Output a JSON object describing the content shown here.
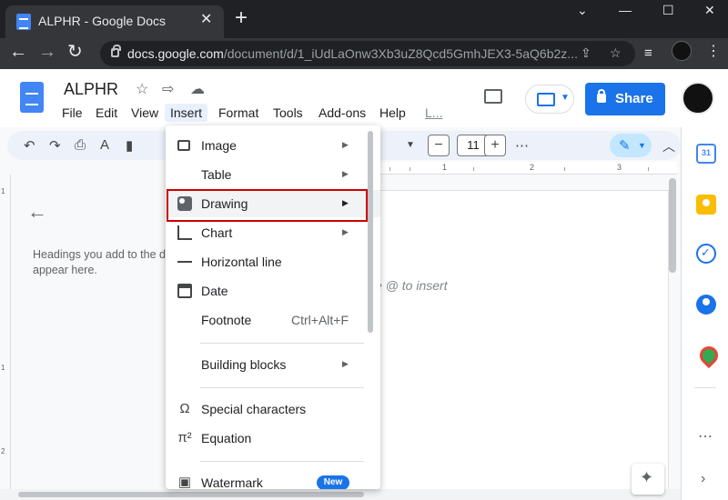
{
  "browser": {
    "tab_title": "ALPHR - Google Docs",
    "url_host": "docs.google.com",
    "url_path": "/document/d/1_iUdLaOnw3Xb3uZ8Qcd5GmhJEX3-5aQ6b2z...",
    "icons": [
      "doc-favicon-icon",
      "close-icon",
      "plus-icon",
      "minimize-icon",
      "maximize-icon",
      "close-window-icon",
      "back-icon",
      "forward-icon",
      "reload-icon",
      "lock-icon",
      "share-icon",
      "star-icon",
      "media-icon",
      "profile-icon",
      "menu-icon"
    ]
  },
  "doc": {
    "title": "ALPHR",
    "menus": [
      "File",
      "Edit",
      "View",
      "Insert",
      "Format",
      "Tools",
      "Add-ons",
      "Help",
      "L..."
    ],
    "active_menu": "Insert",
    "share_label": "Share",
    "accent_color": "#1a73e8"
  },
  "toolbar": {
    "font_size": "11",
    "minus": "−",
    "plus": "+"
  },
  "outline": {
    "hint_line1": "Headings you add to the d",
    "hint_line2": "appear here."
  },
  "page": {
    "placeholder": "e @ to insert"
  },
  "ruler": {
    "h_numbers": [
      "1",
      "2",
      "3"
    ],
    "v_numbers": [
      "1",
      "1",
      "2"
    ]
  },
  "insert_menu": {
    "items": [
      {
        "label": "Image",
        "icon": "image-icon",
        "submenu": true
      },
      {
        "label": "Table",
        "icon": "",
        "submenu": true
      },
      {
        "label": "Drawing",
        "icon": "drawing-icon",
        "submenu": true,
        "highlighted": true
      },
      {
        "label": "Chart",
        "icon": "chart-icon",
        "submenu": true
      },
      {
        "label": "Horizontal line",
        "icon": "horizontal-line-icon",
        "submenu": false
      },
      {
        "label": "Date",
        "icon": "date-icon",
        "submenu": false
      },
      {
        "label": "Footnote",
        "icon": "",
        "shortcut": "Ctrl+Alt+F"
      },
      {
        "label": "Building blocks",
        "icon": "",
        "submenu": true
      },
      {
        "label": "Special characters",
        "icon": "omega-icon"
      },
      {
        "label": "Equation",
        "icon": "pi-icon"
      },
      {
        "label": "Watermark",
        "icon": "watermark-icon",
        "badge": "New"
      }
    ],
    "highlight_color": "#cc0000"
  },
  "side_panel": {
    "calendar_label": "31",
    "icons": [
      "calendar-icon",
      "keep-icon",
      "tasks-icon",
      "contacts-icon",
      "maps-icon",
      "more-icon",
      "chevron-right-icon"
    ]
  }
}
